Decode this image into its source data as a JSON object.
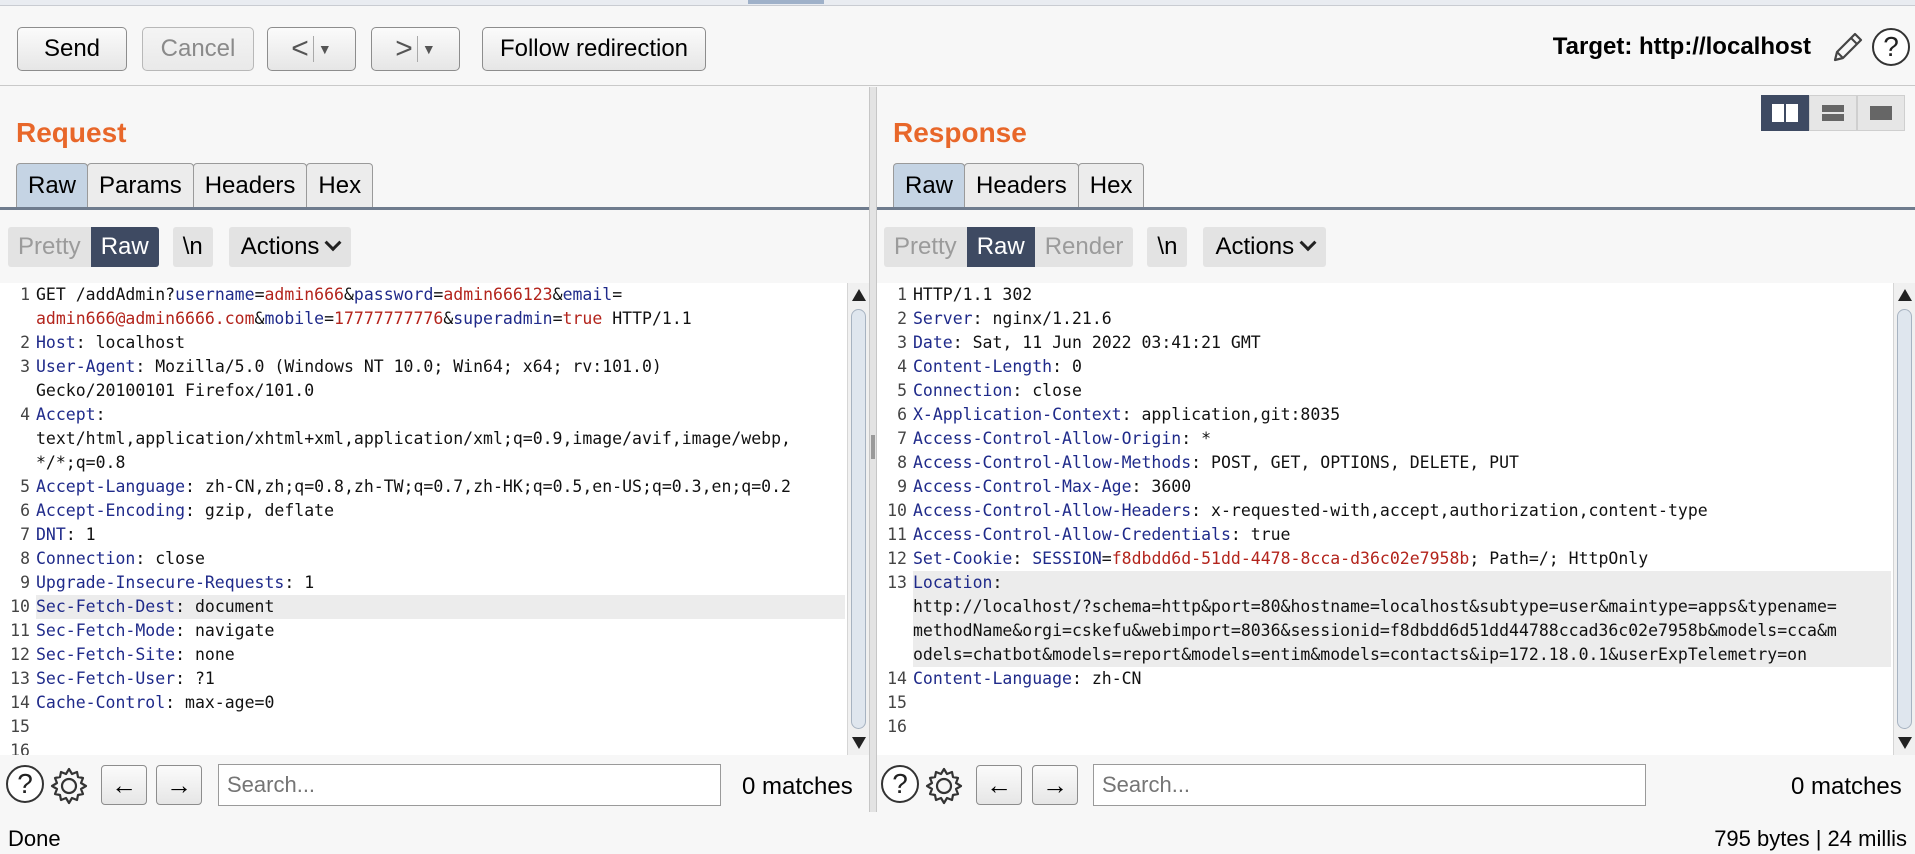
{
  "toolbar": {
    "send_label": "Send",
    "cancel_label": "Cancel",
    "back_label": "<",
    "forward_label": ">",
    "follow_label": "Follow redirection",
    "target_label": "Target: http://localhost",
    "help_label": "?"
  },
  "request": {
    "title": "Request",
    "tabs": [
      "Raw",
      "Params",
      "Headers",
      "Hex"
    ],
    "view_modes": [
      "Pretty",
      "Raw"
    ],
    "newline_label": "\\n",
    "actions_label": "Actions",
    "search_placeholder": "Search...",
    "matches": "0 matches"
  },
  "response": {
    "title": "Response",
    "tabs": [
      "Raw",
      "Headers",
      "Hex"
    ],
    "view_modes": [
      "Pretty",
      "Raw",
      "Render"
    ],
    "newline_label": "\\n",
    "actions_label": "Actions",
    "search_placeholder": "Search...",
    "matches": "0 matches"
  },
  "status": {
    "left": "Done",
    "right": "795 bytes | 24 millis"
  },
  "colors": {
    "title_orange": "#e8672a",
    "active_dark": "#3e4a62",
    "key_blue": "#1f2a8a",
    "value_red": "#b3241c"
  }
}
